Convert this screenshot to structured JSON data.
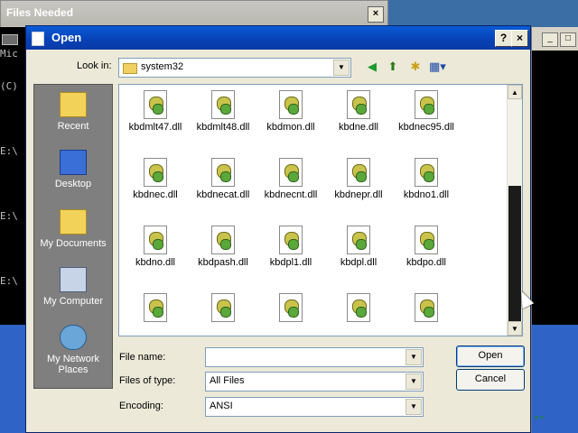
{
  "background": {
    "files_needed_title": "Files Needed",
    "console_lines": [
      "Mic",
      "(C)",
      "",
      "E:\\",
      "",
      "E:\\",
      "",
      "E:\\"
    ]
  },
  "dialog": {
    "title": "Open",
    "help_button": "?",
    "close_button": "×",
    "look_in_label": "Look in:",
    "look_in_value": "system32",
    "places": [
      {
        "label": "Recent",
        "icon": "recent-icon"
      },
      {
        "label": "Desktop",
        "icon": "desktop-icon"
      },
      {
        "label": "My Documents",
        "icon": "my-documents-icon"
      },
      {
        "label": "My Computer",
        "icon": "my-computer-icon"
      },
      {
        "label": "My Network Places",
        "icon": "network-places-icon"
      }
    ],
    "files": [
      "kbdmlt47.dll",
      "kbdmlt48.dll",
      "kbdmon.dll",
      "kbdne.dll",
      "kbdnec95.dll",
      "kbdnec.dll",
      "kbdnecat.dll",
      "kbdnecnt.dll",
      "kbdnepr.dll",
      "kbdno1.dll",
      "kbdno.dll",
      "kbdpash.dll",
      "kbdpl1.dll",
      "kbdpl.dll",
      "kbdpo.dll",
      "",
      "",
      "",
      "",
      ""
    ],
    "file_name_label": "File name:",
    "file_name_value": "",
    "files_of_type_label": "Files of type:",
    "files_of_type_value": "All Files",
    "encoding_label": "Encoding:",
    "encoding_value": "ANSI",
    "open_button": "Open",
    "cancel_button": "Cancel"
  },
  "colors": {
    "titlebar": "#0a5bd6",
    "dialog_bg": "#ece9d8",
    "places_bg": "#7f7f7f"
  }
}
